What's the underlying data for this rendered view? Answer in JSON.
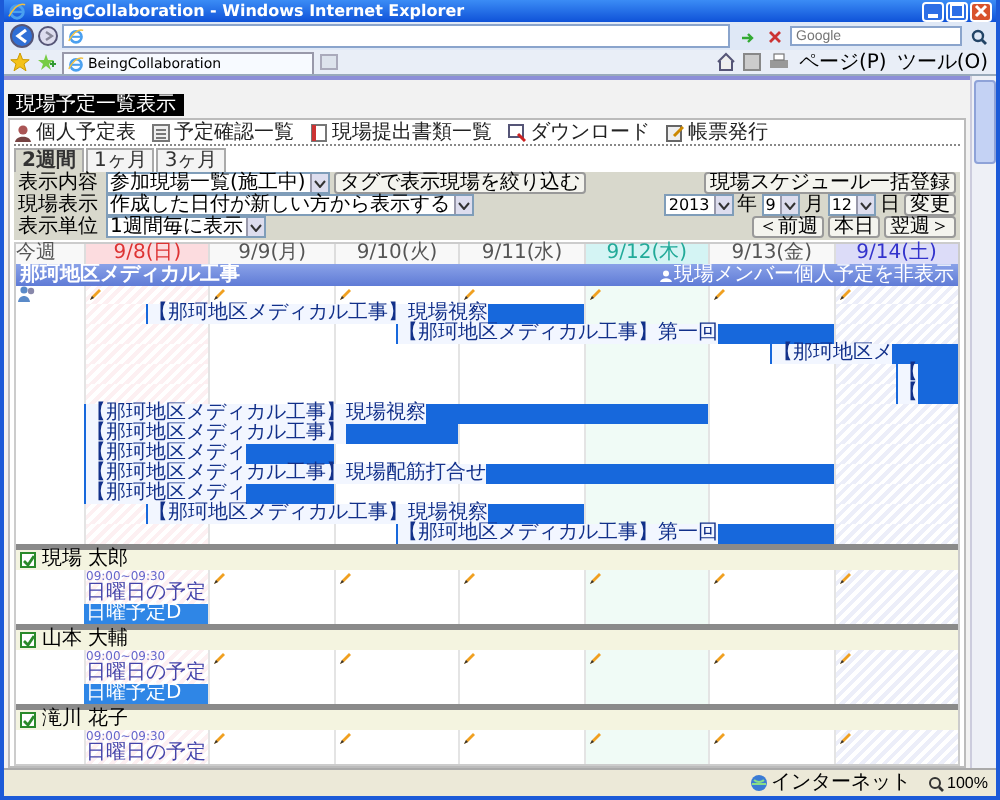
{
  "browser": {
    "title": "BeingCollaboration - Windows Internet Explorer",
    "search_placeholder": "Google",
    "tab": "BeingCollaboration",
    "menus": [
      "ページ(P)",
      "ツール(O)"
    ]
  },
  "page": {
    "heading": "現場予定一覧表示",
    "toolbar": [
      {
        "label": "個人予定表",
        "kind": "person"
      },
      {
        "label": "予定確認一覧",
        "kind": "list"
      },
      {
        "label": "現場提出書類一覧",
        "kind": "document"
      },
      {
        "label": "ダウンロード",
        "kind": "download"
      },
      {
        "label": "帳票発行",
        "kind": "print"
      }
    ],
    "range_tabs": [
      {
        "label": "2週間",
        "selected": true
      },
      {
        "label": "1ヶ月",
        "selected": false
      },
      {
        "label": "3ヶ月",
        "selected": false
      }
    ],
    "filters": [
      {
        "label": "表示内容",
        "value": "参加現場一覧(施工中)"
      },
      {
        "label": "現場表示",
        "value": "作成した日付が新しい方から表示する"
      },
      {
        "label": "表示単位",
        "value": "1週間毎に表示"
      }
    ],
    "tag_button": "タグで表示現場を絞り込む",
    "bulk_button": "現場スケジュール一括登録",
    "date": {
      "year": "2013",
      "year_unit": "年",
      "month": "9",
      "month_unit": "月",
      "day": "12",
      "day_unit": "日",
      "apply": "変更"
    },
    "nav": [
      "＜前週",
      "本日",
      "翌週＞"
    ]
  },
  "calendar": {
    "week_label": "今週",
    "days": [
      {
        "label": "9/8(日)",
        "kind": "sunday"
      },
      {
        "label": "9/9(月)",
        "kind": "weekday"
      },
      {
        "label": "9/10(火)",
        "kind": "weekday"
      },
      {
        "label": "9/11(水)",
        "kind": "weekday"
      },
      {
        "label": "9/12(木)",
        "kind": "today"
      },
      {
        "label": "9/13(金)",
        "kind": "weekday"
      },
      {
        "label": "9/14(土)",
        "kind": "saturday"
      }
    ],
    "site": {
      "name": "那珂地区メディカル工事",
      "toggle": "現場メンバー個人予定を非表示",
      "events": [
        {
          "label": "【那珂地区メディカル工事】現場視察"
        },
        {
          "label": "【那珂地区メディカル工事】第一回"
        },
        {
          "label": "【那珂地区メ"
        },
        {
          "label": "【"
        },
        {
          "label": "【"
        },
        {
          "label": "【那珂地区メディカル工事】現場視察"
        },
        {
          "label": "【那珂地区メディカル工事】"
        },
        {
          "label": "【那珂地区メディ"
        },
        {
          "label": "【那珂地区メディカル工事】現場配筋打合せ"
        },
        {
          "label": "【那珂地区メディ"
        },
        {
          "label": "【那珂地区メディカル工事】現場視察"
        },
        {
          "label": "【那珂地区メディカル工事】第一回"
        }
      ]
    },
    "members": [
      {
        "name": "現場 太郎",
        "checked": true,
        "schedule": {
          "time": "09:00~09:30",
          "title": "日曜日の予定"
        },
        "bars": [
          {
            "label": "日曜予定D"
          }
        ]
      },
      {
        "name": "山本 大輔",
        "checked": true,
        "schedule": {
          "time": "09:00~09:30",
          "title": "日曜日の予定"
        },
        "bars": [
          {
            "label": "日曜予定D"
          }
        ]
      },
      {
        "name": "滝川 花子",
        "checked": true,
        "schedule": {
          "time": "09:00~09:30",
          "title": "日曜日の予定"
        }
      }
    ]
  },
  "status_bar": {
    "zone": "インターネット",
    "zoom": "100%"
  }
}
